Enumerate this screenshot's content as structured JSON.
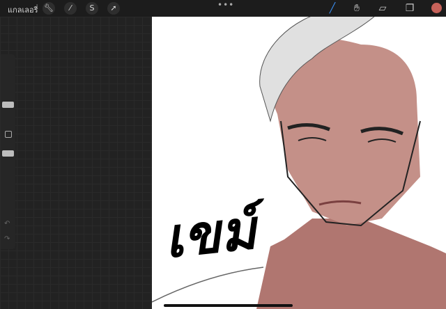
{
  "toolbar": {
    "gallery_label": "แกลเลอรี่",
    "more_label": "•••",
    "left_icons": [
      "wrench-icon",
      "magic-wand-icon",
      "selection-icon",
      "transform-arrow-icon"
    ],
    "right_icons": [
      "brush-icon",
      "smudge-icon",
      "eraser-icon",
      "layers-icon",
      "color-icon"
    ],
    "current_color": "#c6625a",
    "accent": "#3a8ef0"
  },
  "canvas": {
    "handwritten_text": "เขม์"
  }
}
